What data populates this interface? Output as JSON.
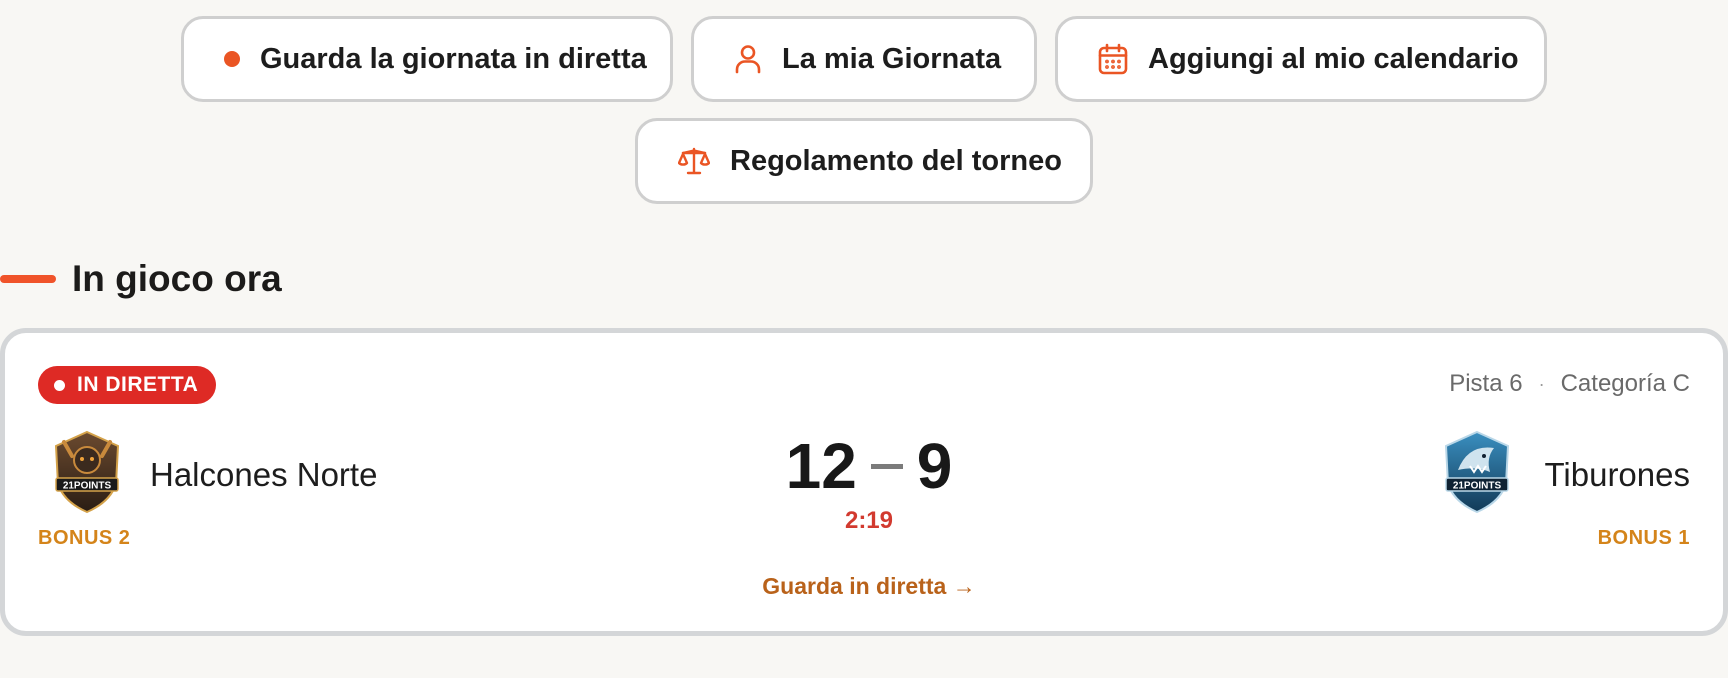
{
  "actions": {
    "live_day": "Guarda la giornata in diretta",
    "my_day": "La mia Giornata",
    "add_calendar": "Aggiungi al mio calendario",
    "rules": "Regolamento del torneo"
  },
  "section": {
    "title": "In gioco ora"
  },
  "match": {
    "status_badge": "IN DIRETTA",
    "court": "Pista 6",
    "meta_separator": "·",
    "category": "Categoría C",
    "home": {
      "name": "Halcones Norte",
      "bonus": "BONUS 2",
      "score": "12",
      "logo_text": "21POINTS"
    },
    "away": {
      "name": "Tiburones",
      "bonus": "BONUS 1",
      "score": "9",
      "logo_text": "21POINTS"
    },
    "clock": "2:19",
    "watch_link": "Guarda in diretta →"
  },
  "colors": {
    "accent": "#ea5524",
    "live_red": "#de2a25",
    "bonus": "#d4841a",
    "link": "#b9621a",
    "timer": "#d23a2f"
  },
  "icons": {
    "live_day": "live-dot-icon",
    "my_day": "user-icon",
    "add_calendar": "calendar-icon",
    "rules": "scale-icon"
  }
}
